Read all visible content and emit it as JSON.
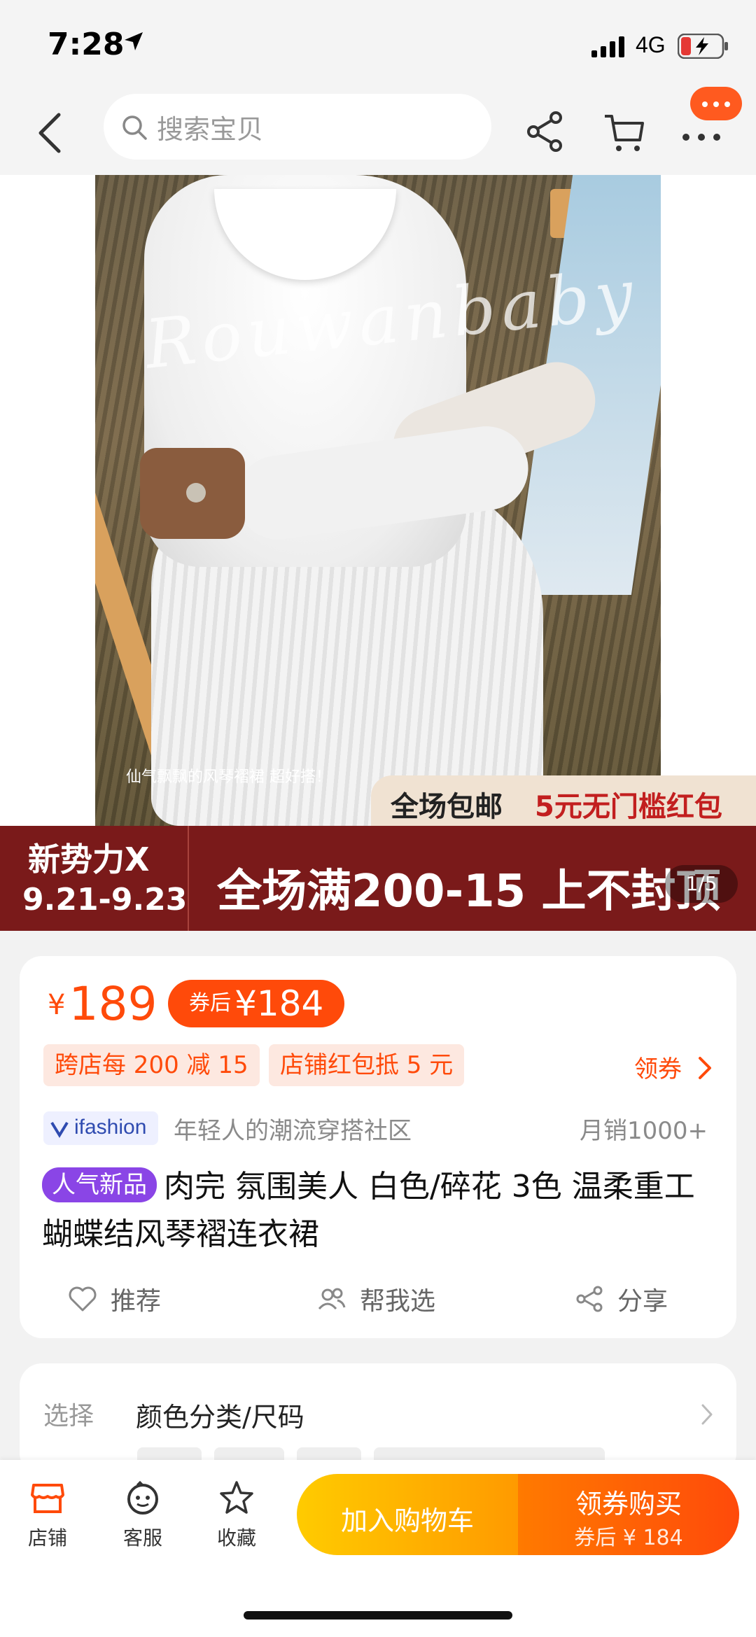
{
  "status_bar": {
    "time": "7:28",
    "network": "4G"
  },
  "nav": {
    "search_placeholder": "搜索宝贝"
  },
  "hero": {
    "watermark": "Rouwanbaby",
    "caption": "仙气飘飘的风琴褶裙 超好搭！",
    "promo_tag_a": "全场包邮",
    "promo_tag_b": "5元无门槛红包",
    "banner_brand": "新势力X",
    "banner_date": "9.21-9.23",
    "banner_main": "全场满200-15 上不封顶",
    "image_counter": "1/5"
  },
  "price_card": {
    "currency": "¥",
    "price": "189",
    "coupon_label": "券后",
    "coupon_price": "¥184",
    "chips": [
      "跨店每 200 减 15",
      "店铺红包抵 5 元"
    ],
    "get_coupon": "领券",
    "brand_badge": "ifashion",
    "slogan": "年轻人的潮流穿搭社区",
    "sales": "月销1000+",
    "badge_new": "人气新品",
    "title": "肉完 氛围美人 白色/碎花 3色 温柔重工蝴蝶结风琴褶连衣裙",
    "actions": {
      "recommend": "推荐",
      "help_choose": "帮我选",
      "share": "分享"
    }
  },
  "sku_card": {
    "label": "选择",
    "value": "颜色分类/尺码"
  },
  "bottom_bar": {
    "tabs": [
      "店铺",
      "客服",
      "收藏"
    ],
    "add_to_cart": "加入购物车",
    "buy_line1": "领券购买",
    "buy_line2": "券后 ¥ 184"
  },
  "colors": {
    "accent": "#ff4a0a",
    "badge_purple": "#8a45e6",
    "banner": "#7a1a1a"
  }
}
